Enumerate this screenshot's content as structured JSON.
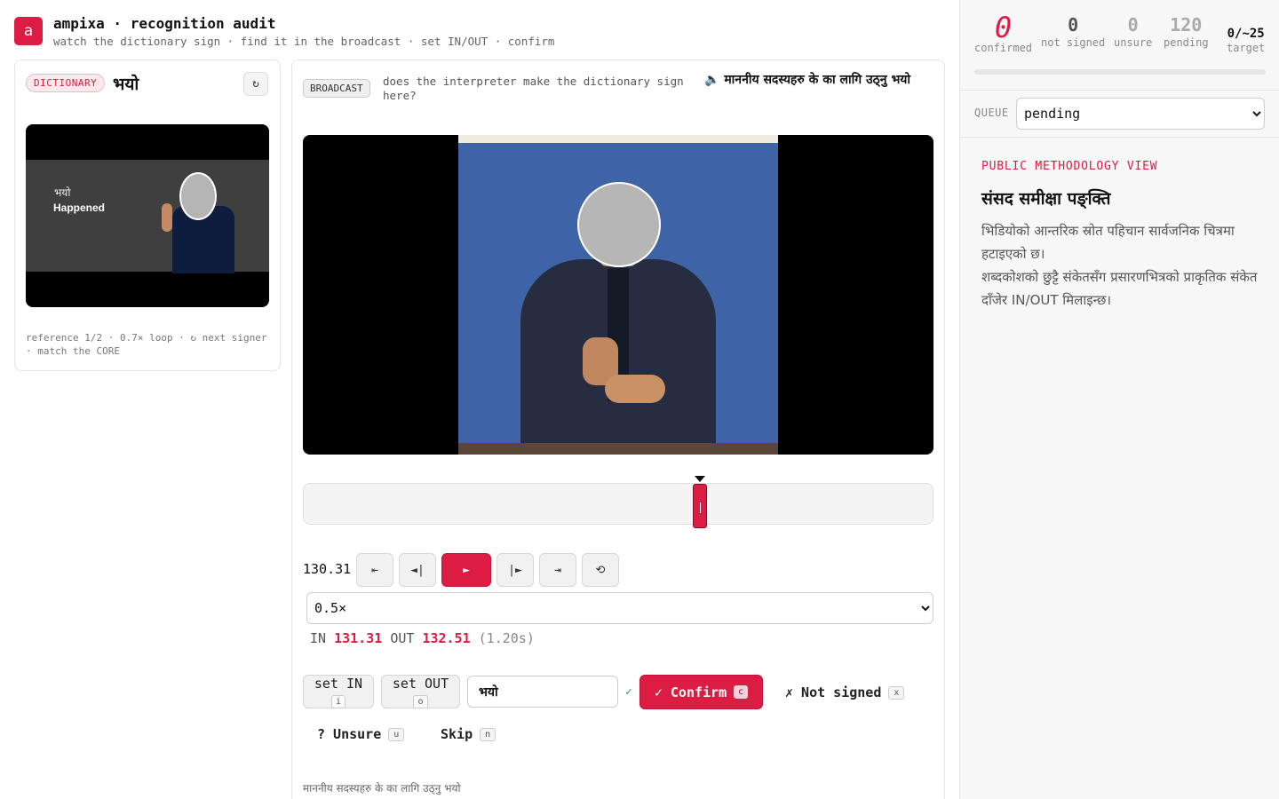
{
  "header": {
    "logo": "a",
    "title": "ampixa · recognition audit",
    "subtitle": "watch the dictionary sign · find it in the broadcast · set IN/OUT · confirm"
  },
  "dictionary": {
    "tag": "DICTIONARY",
    "word": "भयो",
    "refresh_icon": "↻",
    "video_caption_np": "भयो",
    "video_caption_en": "Happened",
    "footer": "reference 1/2 · 0.7× loop · ↻ next signer · match the CORE"
  },
  "broadcast": {
    "tag": "BROADCAST",
    "question": "does the interpreter make the dictionary sign here?",
    "audio_icon": "🔈",
    "audio_text": "माननीय सदस्यहरु के का लागि उठ्नु भयो",
    "playback_fraction": 0.63,
    "time": "130.31",
    "controls": {
      "start": "⇤",
      "prev_frame": "◄|",
      "play": "►",
      "next_frame": "|►",
      "end": "⇥",
      "loop": "⟲"
    },
    "speed": "0.5×",
    "in_label": "IN",
    "in_value": "131.31",
    "out_label": "OUT",
    "out_value": "132.51",
    "duration": "(1.20s)",
    "set_in": {
      "label": "set IN",
      "key": "i"
    },
    "set_out": {
      "label": "set OUT",
      "key": "o"
    },
    "gloss_value": "भयो",
    "gloss_check": "✓",
    "confirm": {
      "label": "✓ Confirm",
      "key": "c"
    },
    "not_signed": {
      "label": "✗ Not signed",
      "key": "x"
    },
    "unsure": {
      "label": "? Unsure",
      "key": "u"
    },
    "skip": {
      "label": "Skip",
      "key": "n"
    },
    "footer": "माननीय सदस्यहरु के का लागि उठ्नु भयो"
  },
  "stats": {
    "confirmed": {
      "value": "0",
      "label": "confirmed"
    },
    "not_signed": {
      "value": "0",
      "label": "not signed"
    },
    "unsure": {
      "value": "0",
      "label": "unsure"
    },
    "pending": {
      "value": "120",
      "label": "pending"
    },
    "target": {
      "value": "0/~25",
      "label": "target"
    },
    "progress": 0
  },
  "queue": {
    "label": "QUEUE",
    "value": "pending"
  },
  "methodology": {
    "label": "PUBLIC METHODOLOGY VIEW",
    "title": "संसद समीक्षा पङ्क्ति",
    "line1": "भिडियोको आन्तरिक स्रोत पहिचान सार्वजनिक चित्रमा हटाइएको छ।",
    "line2": "शब्दकोशको छुट्टै संकेतसँग प्रसारणभित्रको प्राकृतिक संकेत दाँजेर IN/OUT मिलाइन्छ।"
  },
  "colors": {
    "accent": "#dc1c42",
    "success": "#2aa34a"
  }
}
